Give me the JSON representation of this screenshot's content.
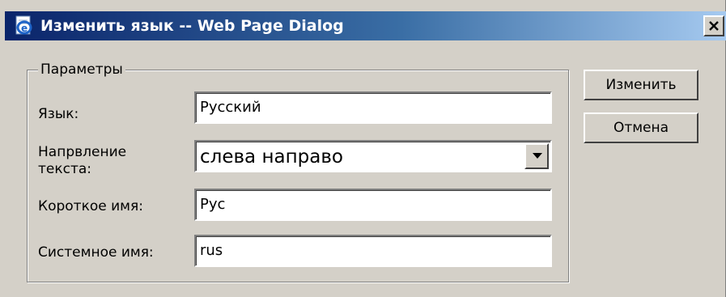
{
  "window": {
    "title": "Изменить язык -- Web Page Dialog",
    "icon": "ie-page-icon",
    "close_label": "close"
  },
  "group": {
    "legend": "Параметры"
  },
  "fields": {
    "language_label": "Язык:",
    "language_value": "Русский",
    "direction_label_line1": "Напрвление",
    "direction_label_line2": "текста:",
    "direction_value": "слева направо",
    "short_name_label": "Короткое имя:",
    "short_name_value": "Рус",
    "system_name_label": "Системное имя:",
    "system_name_value": "rus"
  },
  "buttons": {
    "change_label": "Изменить",
    "cancel_label": "Отмена"
  }
}
